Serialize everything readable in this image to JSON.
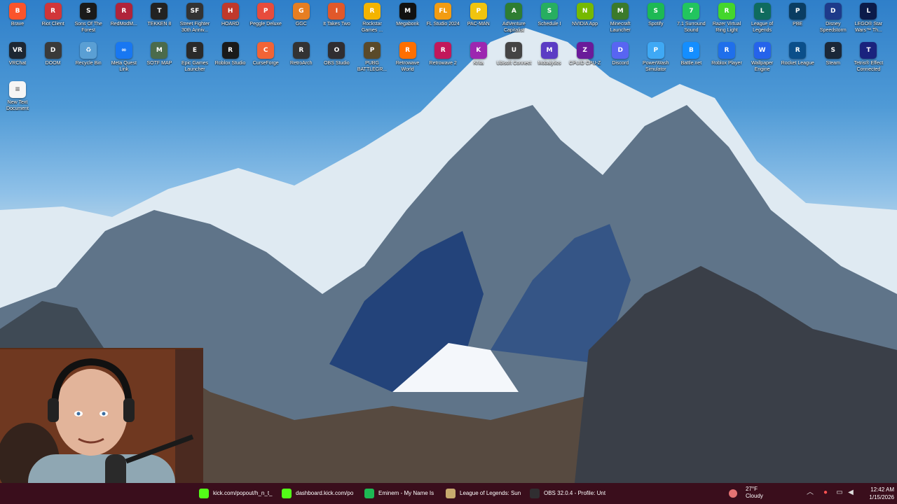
{
  "desktop": {
    "icons_row1": [
      {
        "label": "Brave",
        "abbr": "B",
        "color": "#fb542b"
      },
      {
        "label": "Riot Client",
        "abbr": "R",
        "color": "#d13639"
      },
      {
        "label": "Sons Of The Forest",
        "abbr": "S",
        "color": "#1a1a1a"
      },
      {
        "label": "RedModM...",
        "abbr": "R",
        "color": "#b0243a"
      },
      {
        "label": "TEKKEN 8",
        "abbr": "T",
        "color": "#222"
      },
      {
        "label": "Street Fighter 30th Anniv...",
        "abbr": "SF",
        "color": "#333"
      },
      {
        "label": "HOARD",
        "abbr": "H",
        "color": "#c0392b"
      },
      {
        "label": "Peggle Deluxe",
        "abbr": "P",
        "color": "#e74c3c"
      },
      {
        "label": "GGC",
        "abbr": "G",
        "color": "#e67e22"
      },
      {
        "label": "It Takes Two",
        "abbr": "I",
        "color": "#e1582a"
      },
      {
        "label": "Rockstar Games ...",
        "abbr": "R",
        "color": "#f4b400"
      },
      {
        "label": "Megabonk",
        "abbr": "M",
        "color": "#111"
      },
      {
        "label": "FL Studio 2024",
        "abbr": "FL",
        "color": "#f39c12"
      },
      {
        "label": "PAC-MAN",
        "abbr": "P",
        "color": "#f1c40f"
      },
      {
        "label": "AdVenture Capitalist",
        "abbr": "A",
        "color": "#2e7d32"
      },
      {
        "label": "Schedule I",
        "abbr": "S",
        "color": "#27ae60"
      },
      {
        "label": "NVIDIA App",
        "abbr": "N",
        "color": "#76b900"
      },
      {
        "label": "Minecraft Launcher",
        "abbr": "M",
        "color": "#3b7a2a"
      },
      {
        "label": "Spotify",
        "abbr": "S",
        "color": "#1db954"
      },
      {
        "label": "7.1 Surround Sound",
        "abbr": "7",
        "color": "#22c55e"
      },
      {
        "label": "Razer Virtual Ring Light",
        "abbr": "R",
        "color": "#44d62c"
      },
      {
        "label": "League of Legends",
        "abbr": "L",
        "color": "#0f6b5e"
      },
      {
        "label": "PBE",
        "abbr": "P",
        "color": "#0a3d62"
      },
      {
        "label": "Disney Speedstorm",
        "abbr": "D",
        "color": "#1e3a8a"
      },
      {
        "label": "LEGO® Star Wars™ Th...",
        "abbr": "L",
        "color": "#0b1b4a"
      }
    ],
    "icons_row2": [
      {
        "label": "VRChat",
        "abbr": "VR",
        "color": "#1d2733"
      },
      {
        "label": "DOOM",
        "abbr": "D",
        "color": "#3a3a3a"
      },
      {
        "label": "Recycle Bin",
        "abbr": "♻",
        "color": "#5a9fd4"
      },
      {
        "label": "Meta Quest Link",
        "abbr": "∞",
        "color": "#1877f2"
      },
      {
        "label": "SOTF MAP",
        "abbr": "M",
        "color": "#4b6b4b"
      },
      {
        "label": "Epic Games Launcher",
        "abbr": "E",
        "color": "#2a2a2a"
      },
      {
        "label": "Roblox Studio",
        "abbr": "R",
        "color": "#1a1a1a"
      },
      {
        "label": "CurseForge",
        "abbr": "C",
        "color": "#f16436"
      },
      {
        "label": "RetroArch",
        "abbr": "R",
        "color": "#333"
      },
      {
        "label": "OBS Studio",
        "abbr": "O",
        "color": "#302e31"
      },
      {
        "label": "PUBG BATTLEGR...",
        "abbr": "P",
        "color": "#5a4a2a"
      },
      {
        "label": "Retrowave World",
        "abbr": "R",
        "color": "#ff6f00"
      },
      {
        "label": "Retrowave 2",
        "abbr": "R",
        "color": "#c2185b"
      },
      {
        "label": "Krita",
        "abbr": "K",
        "color": "#9c27b0"
      },
      {
        "label": "Ubisoft Connect",
        "abbr": "U",
        "color": "#444"
      },
      {
        "label": "Mobalytics",
        "abbr": "M",
        "color": "#5b3cc4"
      },
      {
        "label": "CPUID CPU-Z",
        "abbr": "Z",
        "color": "#6a1b9a"
      },
      {
        "label": "Discord",
        "abbr": "D",
        "color": "#5865f2"
      },
      {
        "label": "PowerWash Simulator",
        "abbr": "P",
        "color": "#3fa9f5"
      },
      {
        "label": "Battle.net",
        "abbr": "B",
        "color": "#148eff"
      },
      {
        "label": "Roblox Player",
        "abbr": "R",
        "color": "#1f6feb"
      },
      {
        "label": "Wallpaper Engine",
        "abbr": "W",
        "color": "#2563eb"
      },
      {
        "label": "Rocket League",
        "abbr": "R",
        "color": "#0b4f8a"
      },
      {
        "label": "Steam",
        "abbr": "S",
        "color": "#1b2838"
      },
      {
        "label": "Tetris® Effect Connected",
        "abbr": "T",
        "color": "#1a237e"
      }
    ],
    "icons_row3": [
      {
        "label": "New Text Document",
        "abbr": "≡",
        "color": "#f5f5f5"
      }
    ]
  },
  "taskbar": {
    "apps": [
      {
        "label": "kick.com/popout/h_n_t_",
        "color": "#53fc18"
      },
      {
        "label": "dashboard.kick.com/po",
        "color": "#53fc18"
      },
      {
        "label": "Eminem - My Name Is",
        "color": "#1db954"
      },
      {
        "label": "League of Legends: Sun",
        "color": "#c8aa6e"
      },
      {
        "label": "OBS 32.0.4 - Profile: Unt",
        "color": "#302e31"
      }
    ],
    "weather": {
      "temp": "27°F",
      "condition": "Cloudy"
    },
    "clock": {
      "time": "12:42 AM",
      "date": "1/15/2026"
    }
  }
}
